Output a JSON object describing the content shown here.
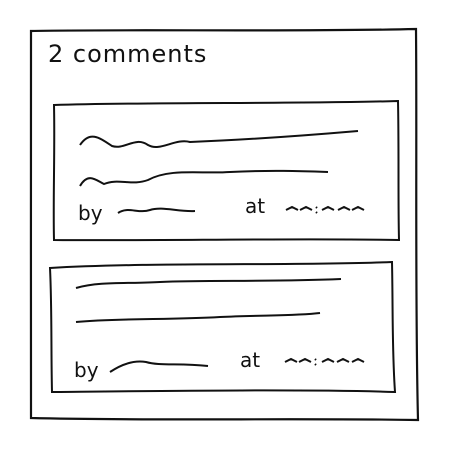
{
  "comments_panel": {
    "heading": "2 comments",
    "comments": [
      {
        "by_label": "by",
        "at_label": "at"
      },
      {
        "by_label": "by",
        "at_label": "at"
      }
    ]
  }
}
